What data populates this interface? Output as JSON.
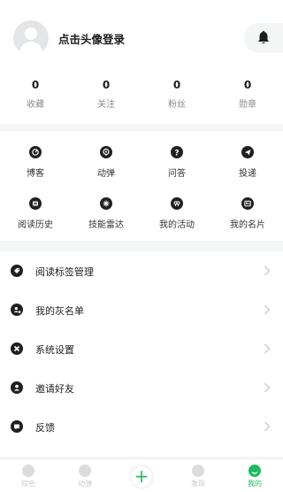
{
  "profile": {
    "login_text": "点击头像登录"
  },
  "stats": [
    {
      "value": "0",
      "label": "收藏"
    },
    {
      "value": "0",
      "label": "关注"
    },
    {
      "value": "0",
      "label": "粉丝"
    },
    {
      "value": "0",
      "label": "勋章"
    }
  ],
  "grid": {
    "row1": [
      {
        "label": "博客",
        "icon": "blog-icon"
      },
      {
        "label": "动弹",
        "icon": "tweet-icon"
      },
      {
        "label": "问答",
        "icon": "question-icon"
      },
      {
        "label": "投递",
        "icon": "send-icon"
      }
    ],
    "row2": [
      {
        "label": "阅读历史",
        "icon": "history-icon"
      },
      {
        "label": "技能雷达",
        "icon": "radar-icon"
      },
      {
        "label": "我的活动",
        "icon": "activity-icon"
      },
      {
        "label": "我的名片",
        "icon": "card-icon"
      }
    ]
  },
  "menu": [
    {
      "label": "阅读标签管理",
      "icon": "tag-icon"
    },
    {
      "label": "我的灰名单",
      "icon": "greylist-icon"
    },
    {
      "label": "系统设置",
      "icon": "settings-icon"
    },
    {
      "label": "邀请好友",
      "icon": "invite-icon"
    },
    {
      "label": "反馈",
      "icon": "feedback-icon"
    }
  ],
  "tabbar": {
    "tab1": "综合",
    "tab2": "动弹",
    "plus": "+",
    "tab4": "发现",
    "tab5": "我的"
  },
  "colors": {
    "accent": "#1fba5f",
    "background": "#f4f5f5",
    "icon": "#202020"
  }
}
